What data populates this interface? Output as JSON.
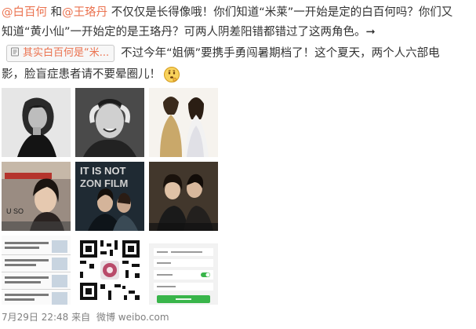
{
  "post": {
    "mention_1": "@白百何",
    "text_and": " 和",
    "mention_2": "@王珞丹",
    "text_1": " 不仅仅是长得像哦！你们知道“米莱”一开始是定的白百何吗？你们又",
    "text_2": "知道“黄小仙”一开始定的是王珞丹？可两人阴差阳错都错过了这两角色。➞",
    "link_label": "其实白百何是“米...",
    "text_3": "不过今年“姐俩”要携手勇闯暑期档了！这个夏天，两个人六部电",
    "text_4": "影，脸盲症患者请不要晕圈儿！",
    "emoji_name": "thinking-face-emoji"
  },
  "images": [
    {
      "name": "photo-bw-portrait-woman"
    },
    {
      "name": "photo-bw-smiling-woman"
    },
    {
      "name": "photo-two-women-poster"
    },
    {
      "name": "photo-video-still-woman"
    },
    {
      "name": "photo-movie-poster",
      "caption": "IT IS NOT",
      "caption_2": "ZON FILM"
    },
    {
      "name": "photo-movie-poster-couple"
    },
    {
      "name": "photo-news-list-screenshot"
    },
    {
      "name": "photo-qr-code"
    },
    {
      "name": "photo-app-settings-screenshot"
    }
  ],
  "footer": {
    "date": "7月29日 22:48",
    "from": "来自",
    "source": "微博 weibo.com"
  },
  "colors": {
    "mention": "#eb7350",
    "text": "#333333",
    "meta": "#808080"
  }
}
